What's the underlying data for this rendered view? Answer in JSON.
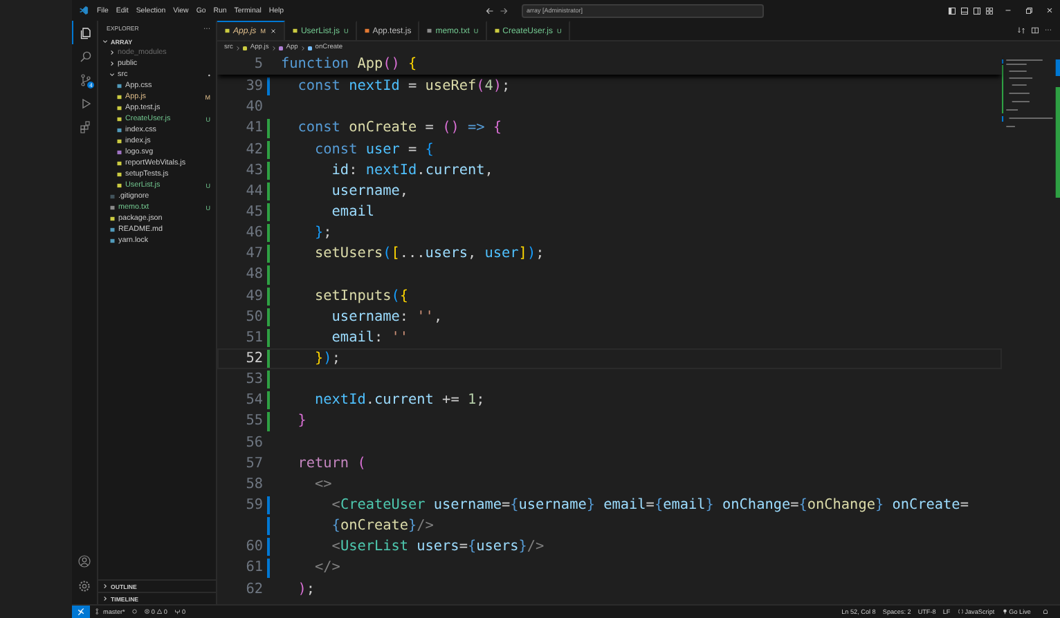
{
  "title_bar": {
    "menu": [
      "File",
      "Edit",
      "Selection",
      "View",
      "Go",
      "Run",
      "Terminal",
      "Help"
    ],
    "search": "array [Administrator]"
  },
  "activity_bar": {
    "items": [
      {
        "kind": "files",
        "selected": true
      },
      {
        "kind": "search",
        "selected": false
      },
      {
        "kind": "source-control",
        "selected": false,
        "badge": "4"
      },
      {
        "kind": "run",
        "selected": false
      },
      {
        "kind": "extensions",
        "selected": false
      }
    ]
  },
  "sidebar": {
    "title": "EXPLORER",
    "more": "···",
    "tree": [
      {
        "name": "ARRAY",
        "kind": "root",
        "expanded": true,
        "children": [
          {
            "name": "node_modules",
            "kind": "folder",
            "expanded": false,
            "color": "#6b6b6b"
          },
          {
            "name": "public",
            "kind": "folder",
            "expanded": false
          },
          {
            "name": "src",
            "kind": "folder",
            "expanded": true,
            "badge": "•",
            "children": [
              {
                "name": "App.css",
                "kind": "css"
              },
              {
                "name": "App.js",
                "kind": "js",
                "color": "#e2c08d",
                "badge": "M"
              },
              {
                "name": "App.test.js",
                "kind": "js"
              },
              {
                "name": "CreateUser.js",
                "kind": "js",
                "color": "#73c991",
                "badge": "U"
              },
              {
                "name": "index.css",
                "kind": "css"
              },
              {
                "name": "index.js",
                "kind": "js"
              },
              {
                "name": "logo.svg",
                "kind": "svg"
              },
              {
                "name": "reportWebVitals.js",
                "kind": "js"
              },
              {
                "name": "setupTests.js",
                "kind": "js"
              },
              {
                "name": "UserList.js",
                "kind": "js",
                "color": "#73c991",
                "badge": "U"
              }
            ]
          },
          {
            "name": ".gitignore",
            "kind": "git"
          },
          {
            "name": "memo.txt",
            "kind": "txt",
            "color": "#73c991",
            "badge": "U"
          },
          {
            "name": "package.json",
            "kind": "json"
          },
          {
            "name": "README.md",
            "kind": "md"
          },
          {
            "name": "yarn.lock",
            "kind": "lock"
          }
        ]
      }
    ],
    "panels": [
      {
        "label": "OUTLINE",
        "expanded": false
      },
      {
        "label": "TIMELINE",
        "expanded": false
      }
    ]
  },
  "tabs": [
    {
      "label": "App.js",
      "kind": "js",
      "selected": true,
      "color": "#e2c08d",
      "badge": "M"
    },
    {
      "label": "UserList.js",
      "kind": "js",
      "selected": false,
      "color": "#73c991",
      "badge": "U"
    },
    {
      "label": "App.test.js",
      "kind": "test",
      "selected": false
    },
    {
      "label": "memo.txt",
      "kind": "txt",
      "selected": false,
      "color": "#73c991",
      "badge": "U"
    },
    {
      "label": "CreateUser.js",
      "kind": "js",
      "selected": false,
      "color": "#73c991",
      "badge": "U"
    }
  ],
  "breadcrumb": [
    {
      "label": "src",
      "kind": "folder"
    },
    {
      "label": "App.js",
      "kind": "js"
    },
    {
      "label": "App",
      "kind": "component"
    },
    {
      "label": "onCreate",
      "kind": "variable"
    }
  ],
  "editor": {
    "sticky": {
      "number": "5",
      "tokens": [
        {
          "text": "function ",
          "kind": "kw"
        },
        {
          "text": "App",
          "kind": "fn"
        },
        {
          "text": "() ",
          "kind": "b2"
        },
        {
          "text": "{",
          "kind": "b1"
        }
      ]
    },
    "lines": [
      {
        "number": "39",
        "color": "#0078d4",
        "tokens": [
          {
            "text": "  const ",
            "kind": "kw"
          },
          {
            "text": "nextId",
            "kind": "cst"
          },
          {
            "text": " = ",
            "kind": "p"
          },
          {
            "text": "useRef",
            "kind": "fn"
          },
          {
            "text": "(",
            "kind": "b2"
          },
          {
            "text": "4",
            "kind": "num"
          },
          {
            "text": ")",
            "kind": "b2"
          },
          {
            "text": ";",
            "kind": "p"
          }
        ]
      },
      {
        "number": "40"
      },
      {
        "number": "41",
        "color": "#2ea043",
        "tokens": [
          {
            "text": "  const ",
            "kind": "kw"
          },
          {
            "text": "onCreate",
            "kind": "fn"
          },
          {
            "text": " = ",
            "kind": "p"
          },
          {
            "text": "()",
            "kind": "b2"
          },
          {
            "text": " => ",
            "kind": "kw"
          },
          {
            "text": "{",
            "kind": "b2"
          }
        ]
      },
      {
        "number": "42",
        "color": "#2ea043",
        "tokens": [
          {
            "text": "    const ",
            "kind": "kw"
          },
          {
            "text": "user",
            "kind": "cst"
          },
          {
            "text": " = ",
            "kind": "p"
          },
          {
            "text": "{",
            "kind": "b3"
          }
        ]
      },
      {
        "number": "43",
        "color": "#2ea043",
        "tokens": [
          {
            "text": "      id",
            "kind": "var"
          },
          {
            "text": ": ",
            "kind": "p"
          },
          {
            "text": "nextId",
            "kind": "cst"
          },
          {
            "text": ".",
            "kind": "p"
          },
          {
            "text": "current",
            "kind": "var"
          },
          {
            "text": ",",
            "kind": "p"
          }
        ]
      },
      {
        "number": "44",
        "color": "#2ea043",
        "tokens": [
          {
            "text": "      username",
            "kind": "var"
          },
          {
            "text": ",",
            "kind": "p"
          }
        ]
      },
      {
        "number": "45",
        "color": "#2ea043",
        "tokens": [
          {
            "text": "      email",
            "kind": "var"
          }
        ]
      },
      {
        "number": "46",
        "color": "#2ea043",
        "tokens": [
          {
            "text": "    }",
            "kind": "b3"
          },
          {
            "text": ";",
            "kind": "p"
          }
        ]
      },
      {
        "number": "47",
        "color": "#2ea043",
        "tokens": [
          {
            "text": "    setUsers",
            "kind": "fn"
          },
          {
            "text": "(",
            "kind": "b3"
          },
          {
            "text": "[",
            "kind": "b1"
          },
          {
            "text": "...",
            "kind": "p"
          },
          {
            "text": "users",
            "kind": "var"
          },
          {
            "text": ", ",
            "kind": "p"
          },
          {
            "text": "user",
            "kind": "cst"
          },
          {
            "text": "]",
            "kind": "b1"
          },
          {
            "text": ")",
            "kind": "b3"
          },
          {
            "text": ";",
            "kind": "p"
          }
        ]
      },
      {
        "number": "48",
        "color": "#2ea043"
      },
      {
        "number": "49",
        "color": "#2ea043",
        "tokens": [
          {
            "text": "    setInputs",
            "kind": "fn"
          },
          {
            "text": "(",
            "kind": "b3"
          },
          {
            "text": "{",
            "kind": "b1"
          }
        ]
      },
      {
        "number": "50",
        "color": "#2ea043",
        "tokens": [
          {
            "text": "      username",
            "kind": "var"
          },
          {
            "text": ": ",
            "kind": "p"
          },
          {
            "text": "''",
            "kind": "str"
          },
          {
            "text": ",",
            "kind": "p"
          }
        ]
      },
      {
        "number": "51",
        "color": "#2ea043",
        "tokens": [
          {
            "text": "      email",
            "kind": "var"
          },
          {
            "text": ": ",
            "kind": "p"
          },
          {
            "text": "''",
            "kind": "str"
          }
        ]
      },
      {
        "number": "52",
        "color": "#2ea043",
        "current": true,
        "tokens": [
          {
            "text": "    }",
            "kind": "b1"
          },
          {
            "text": ")",
            "kind": "b3"
          },
          {
            "text": ";",
            "kind": "p"
          }
        ]
      },
      {
        "number": "53",
        "color": "#2ea043"
      },
      {
        "number": "54",
        "color": "#2ea043",
        "tokens": [
          {
            "text": "    nextId",
            "kind": "cst"
          },
          {
            "text": ".",
            "kind": "p"
          },
          {
            "text": "current",
            "kind": "var"
          },
          {
            "text": " += ",
            "kind": "p"
          },
          {
            "text": "1",
            "kind": "num"
          },
          {
            "text": ";",
            "kind": "p"
          }
        ]
      },
      {
        "number": "55",
        "color": "#2ea043",
        "tokens": [
          {
            "text": "  }",
            "kind": "b2"
          }
        ]
      },
      {
        "number": "56"
      },
      {
        "number": "57",
        "tokens": [
          {
            "text": "  return ",
            "kind": "ctrl"
          },
          {
            "text": "(",
            "kind": "b2"
          }
        ]
      },
      {
        "number": "58",
        "tokens": [
          {
            "text": "    <>",
            "kind": "tagp"
          }
        ]
      },
      {
        "number": "59",
        "color": "#0078d4",
        "tokens": [
          {
            "text": "      <",
            "kind": "tagp"
          },
          {
            "text": "CreateUser ",
            "kind": "comp"
          },
          {
            "text": "username",
            "kind": "var"
          },
          {
            "text": "=",
            "kind": "p"
          },
          {
            "text": "{",
            "kind": "jsxb"
          },
          {
            "text": "username",
            "kind": "var"
          },
          {
            "text": "} ",
            "kind": "jsxb"
          },
          {
            "text": "email",
            "kind": "var"
          },
          {
            "text": "=",
            "kind": "p"
          },
          {
            "text": "{",
            "kind": "jsxb"
          },
          {
            "text": "email",
            "kind": "var"
          },
          {
            "text": "} ",
            "kind": "jsxb"
          },
          {
            "text": "onChange",
            "kind": "var"
          },
          {
            "text": "=",
            "kind": "p"
          },
          {
            "text": "{",
            "kind": "jsxb"
          },
          {
            "text": "onChange",
            "kind": "fn"
          },
          {
            "text": "} ",
            "kind": "jsxb"
          },
          {
            "text": "onCreate",
            "kind": "var"
          },
          {
            "text": "=",
            "kind": "p"
          }
        ],
        "wrap": [
          {
            "text": "      {",
            "kind": "jsxb"
          },
          {
            "text": "onCreate",
            "kind": "fn"
          },
          {
            "text": "}",
            "kind": "jsxb"
          },
          {
            "text": "/>",
            "kind": "tagp"
          }
        ]
      },
      {
        "number": "60",
        "color": "#0078d4",
        "tokens": [
          {
            "text": "      <",
            "kind": "tagp"
          },
          {
            "text": "UserList ",
            "kind": "comp"
          },
          {
            "text": "users",
            "kind": "var"
          },
          {
            "text": "=",
            "kind": "p"
          },
          {
            "text": "{",
            "kind": "jsxb"
          },
          {
            "text": "users",
            "kind": "var"
          },
          {
            "text": "}",
            "kind": "jsxb"
          },
          {
            "text": "/>",
            "kind": "tagp"
          }
        ]
      },
      {
        "number": "61",
        "color": "#0078d4",
        "tokens": [
          {
            "text": "    </>",
            "kind": "tagp"
          }
        ]
      },
      {
        "number": "62",
        "tokens": [
          {
            "text": "  )",
            "kind": "b2"
          },
          {
            "text": ";",
            "kind": "p"
          }
        ]
      }
    ]
  },
  "status_bar": {
    "branch": "master*",
    "errors": "0",
    "warnings": "0",
    "ports": "0",
    "right": [
      {
        "label": "Ln 52, Col 8",
        "kind": "text"
      },
      {
        "label": "Spaces: 2",
        "kind": "text"
      },
      {
        "label": "UTF-8",
        "kind": "text"
      },
      {
        "label": "LF",
        "kind": "text"
      },
      {
        "label": "JavaScript",
        "kind": "language"
      },
      {
        "label": "Go Live",
        "kind": "live"
      }
    ]
  }
}
